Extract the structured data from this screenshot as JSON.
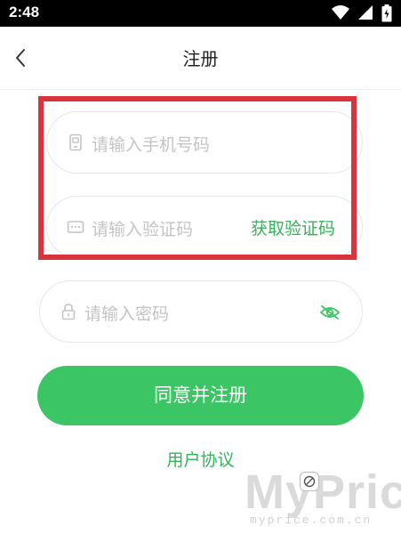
{
  "status_bar": {
    "time": "2:48",
    "icons": [
      "wifi-icon",
      "cellular-signal-icon",
      "battery-icon"
    ]
  },
  "header": {
    "title": "注册",
    "back_icon": "chevron-left-icon"
  },
  "form": {
    "phone": {
      "placeholder": "请输入手机号码",
      "value": "",
      "icon": "phone-icon"
    },
    "code": {
      "placeholder": "请输入验证码",
      "value": "",
      "icon": "message-icon",
      "action_label": "获取验证码"
    },
    "password": {
      "placeholder": "请输入密码",
      "value": "",
      "icon": "lock-icon",
      "toggle_icon": "eye-hidden-icon"
    }
  },
  "actions": {
    "register_label": "同意并注册",
    "agreement_label": "用户协议"
  },
  "watermark": {
    "text": "MyPrice",
    "url": "myprice.com.cn"
  },
  "colors": {
    "accent": "#3cc564",
    "accent_text": "#34b45a",
    "highlight": "#d9343b",
    "placeholder": "#c4c4c4"
  }
}
